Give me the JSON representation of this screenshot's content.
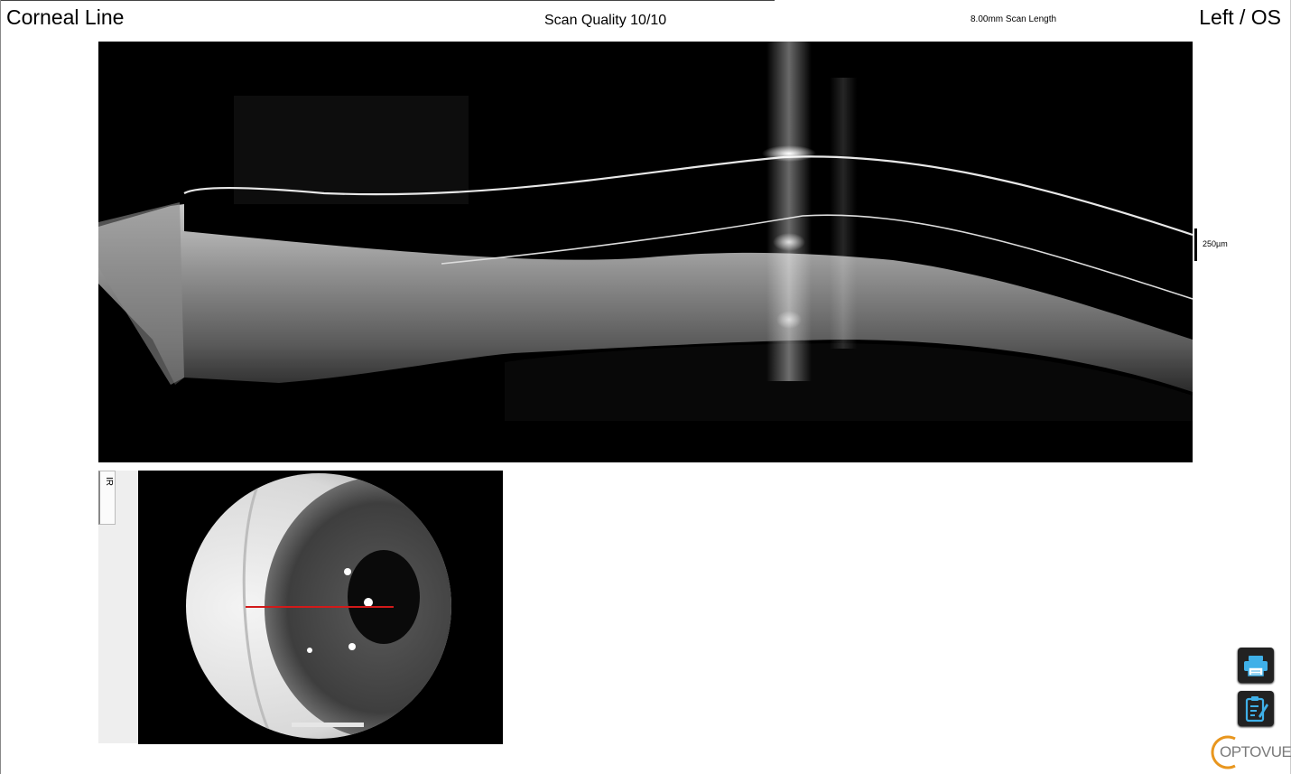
{
  "header": {
    "title": "Corneal Line",
    "scan_quality": "Scan Quality 10/10",
    "scan_length": "8.00mm Scan Length",
    "eye": "Left / OS"
  },
  "oct_image": {
    "scale_bar_label": "250µm"
  },
  "ir_panel": {
    "tab_label": "IR",
    "scan_line_color": "#d21a1a"
  },
  "toolbar": {
    "print_icon": "printer-icon",
    "report_icon": "clipboard-edit-icon"
  },
  "brand": {
    "logo_text": "OPTOVUE",
    "logo_color": "#e8961e"
  }
}
